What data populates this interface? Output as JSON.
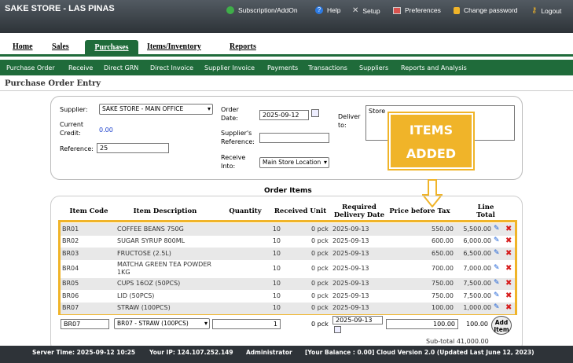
{
  "app": {
    "title": "SAKE STORE - LAS PINAS"
  },
  "toplinks": [
    {
      "label": "Subscription/AddOn",
      "icon": "globe-icon"
    },
    {
      "label": "Help",
      "icon": "help-icon"
    },
    {
      "label": "Setup",
      "icon": "tools-icon"
    },
    {
      "label": "Preferences",
      "icon": "monitor-icon"
    },
    {
      "label": "Change password",
      "icon": "lock-icon"
    },
    {
      "label": "Logout",
      "icon": "key-icon"
    }
  ],
  "mainmenu": {
    "home": "Home",
    "sales": "Sales",
    "purchases": "Purchases",
    "items": "Items/Inventory",
    "reports": "Reports"
  },
  "submenu": [
    "Purchase Order",
    "Receive",
    "Direct GRN",
    "Direct Invoice",
    "Supplier Invoice",
    "Payments",
    "Transactions",
    "Suppliers",
    "Reports and Analysis"
  ],
  "page": {
    "title": "Purchase Order Entry"
  },
  "header": {
    "supplier_label": "Supplier:",
    "supplier_value": "SAKE STORE - MAIN OFFICE",
    "credit_label": "Current Credit:",
    "credit_value": "0.00",
    "reference_label": "Reference:",
    "reference_value": "25",
    "order_date_label": "Order Date:",
    "order_date_value": "2025-09-12",
    "supplier_ref_label": "Supplier's Reference:",
    "supplier_ref_value": "",
    "receive_into_label": "Receive Into:",
    "receive_into_value": "Main Store Location",
    "deliver_to_label": "Deliver to:",
    "deliver_to_value": "Store"
  },
  "callout": {
    "line1": "ITEMS",
    "line2": "ADDED",
    "color": "#f0b429"
  },
  "order_items": {
    "title": "Order Items",
    "columns": [
      "Item Code",
      "Item Description",
      "Quantity",
      "Received Unit",
      "Required Delivery Date",
      "Price before Tax",
      "Line Total"
    ],
    "rows": [
      {
        "code": "BR01",
        "desc": "COFFEE BEANS 750G",
        "qty": "10",
        "recv": "0 pck",
        "date": "2025-09-13",
        "price": "550.00",
        "total": "5,500.00"
      },
      {
        "code": "BR02",
        "desc": "SUGAR SYRUP 800ML",
        "qty": "10",
        "recv": "0 pck",
        "date": "2025-09-13",
        "price": "600.00",
        "total": "6,000.00"
      },
      {
        "code": "BR03",
        "desc": "FRUCTOSE (2.5L)",
        "qty": "10",
        "recv": "0 pck",
        "date": "2025-09-13",
        "price": "650.00",
        "total": "6,500.00"
      },
      {
        "code": "BR04",
        "desc": "MATCHA GREEN TEA POWDER 1KG",
        "qty": "10",
        "recv": "0 pck",
        "date": "2025-09-13",
        "price": "700.00",
        "total": "7,000.00"
      },
      {
        "code": "BR05",
        "desc": "CUPS 16OZ (50PCS)",
        "qty": "10",
        "recv": "0 pck",
        "date": "2025-09-13",
        "price": "750.00",
        "total": "7,500.00"
      },
      {
        "code": "BR06",
        "desc": "LID (50PCS)",
        "qty": "10",
        "recv": "0 pck",
        "date": "2025-09-13",
        "price": "750.00",
        "total": "7,500.00"
      },
      {
        "code": "BR07",
        "desc": "STRAW (100PCS)",
        "qty": "10",
        "recv": "0 pck",
        "date": "2025-09-13",
        "price": "100.00",
        "total": "1,000.00"
      }
    ],
    "new_row": {
      "code": "BR07",
      "item_select": "BR07 - STRAW (100PCS)",
      "qty": "1",
      "recv": "0 pck",
      "date": "2025-09-13",
      "price": "100.00",
      "total": "100.00",
      "add_label": "Add Item"
    },
    "subtotal": "Sub-total 41,000.00"
  },
  "status": {
    "server_time": "Server Time: 2025-09-12 10:25",
    "ip": "Your IP: 124.107.252.149",
    "user": "Administrator",
    "version": "[Your Balance : 0.00] Cloud Version 2.0 (Updated Last June 12, 2023)"
  }
}
